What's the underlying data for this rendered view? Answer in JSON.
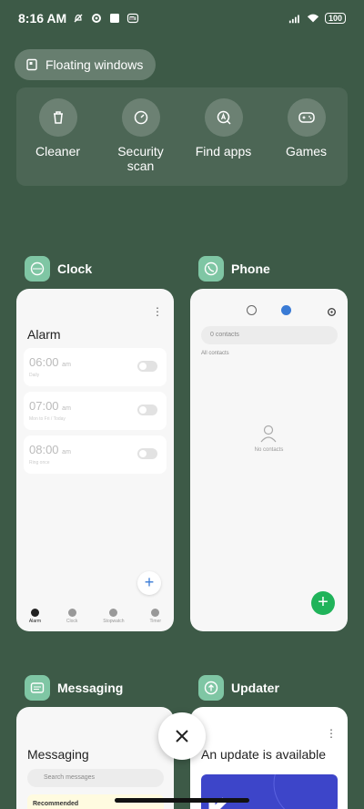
{
  "status": {
    "time": "8:16 AM",
    "battery": "100"
  },
  "floating_windows": {
    "label": "Floating windows"
  },
  "quick_actions": [
    {
      "label": "Cleaner",
      "icon": "trash-icon"
    },
    {
      "label": "Security scan",
      "icon": "security-scan-icon"
    },
    {
      "label": "Find apps",
      "icon": "find-apps-icon"
    },
    {
      "label": "Games",
      "icon": "gamepad-icon"
    }
  ],
  "apps": {
    "clock": {
      "name": "Clock",
      "title": "Alarm",
      "alarms": [
        {
          "time": "06:00",
          "ampm": "am",
          "sub": "Daily"
        },
        {
          "time": "07:00",
          "ampm": "am",
          "sub": "Mon to Fri / Today"
        },
        {
          "time": "08:00",
          "ampm": "am",
          "sub": "Ring once"
        }
      ],
      "tabs": [
        "Alarm",
        "Clock",
        "Stopwatch",
        "Timer"
      ]
    },
    "phone": {
      "name": "Phone",
      "search_placeholder": "0 contacts",
      "filter": "All contacts",
      "empty": "No contacts"
    },
    "messaging": {
      "name": "Messaging",
      "title": "Messaging",
      "search_placeholder": "Search messages",
      "recommended": "Recommended"
    },
    "updater": {
      "name": "Updater",
      "title": "An update is available"
    }
  },
  "colors": {
    "background": "#3d5a47",
    "fab_green": "#20b35a",
    "accent_blue": "#3a7bd5",
    "updater_banner": "#3d45c9"
  }
}
